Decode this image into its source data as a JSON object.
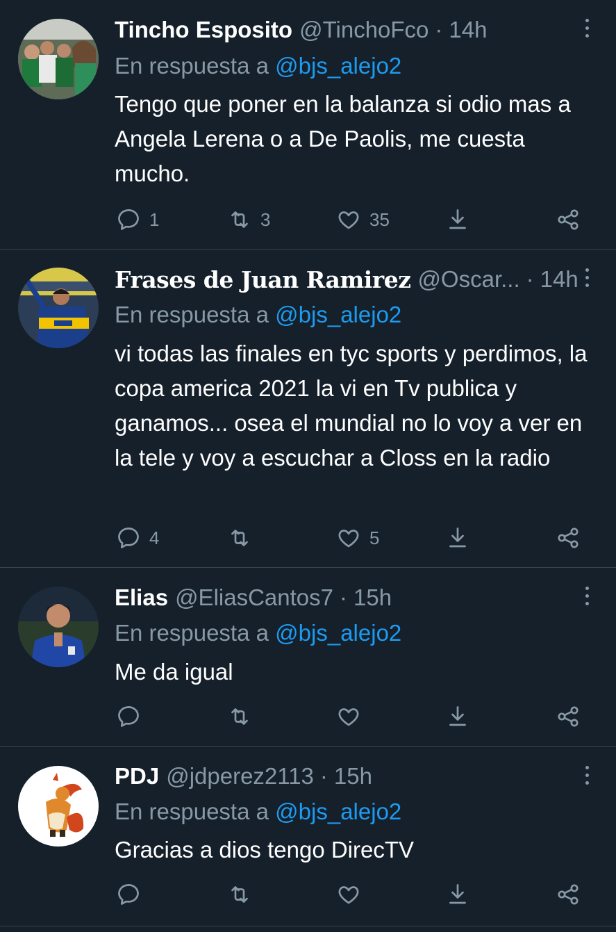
{
  "tweets": [
    {
      "name": "Tincho Esposito",
      "handle": "@TinchoFco",
      "separator": "·",
      "time": "14h",
      "reply_prefix": "En respuesta a",
      "reply_to": "@bjs_alejo2",
      "text": "Tengo que poner en la balanza si odio mas a Angela Lerena o a De Paolis, me cuesta mucho.",
      "replies": "1",
      "retweets": "3",
      "likes": "35"
    },
    {
      "name": "Frases de Juan Ramirez",
      "handle": "@Oscar...",
      "separator": "·",
      "time": "14h",
      "reply_prefix": "En respuesta a",
      "reply_to": "@bjs_alejo2",
      "text": "vi todas las finales en tyc sports y perdimos, la copa america 2021 la vi en Tv publica y ganamos... osea el mundial no lo voy a ver en la tele y voy a escuchar a Closs en la radio",
      "replies": "4",
      "retweets": "",
      "likes": "5"
    },
    {
      "name": "Elias",
      "handle": "@EliasCantos7",
      "separator": "·",
      "time": "15h",
      "reply_prefix": "En respuesta a",
      "reply_to": "@bjs_alejo2",
      "text": "Me da igual",
      "replies": "",
      "retweets": "",
      "likes": ""
    },
    {
      "name": "PDJ",
      "handle": "@jdperez2113",
      "separator": "·",
      "time": "15h",
      "reply_prefix": "En respuesta a",
      "reply_to": "@bjs_alejo2",
      "text": "Gracias a dios tengo DirecTV",
      "replies": "",
      "retweets": "",
      "likes": ""
    }
  ],
  "icons": {
    "reply": "speech-bubble-icon",
    "retweet": "retweet-icon",
    "like": "heart-icon",
    "share": "share-icon",
    "export": "download-arrow-icon",
    "more": "more-vertical-icon"
  },
  "colors": {
    "background": "#15202b",
    "text": "#ffffff",
    "muted": "#8899a6",
    "mention": "#1d9bf0",
    "divider": "#38444d"
  }
}
